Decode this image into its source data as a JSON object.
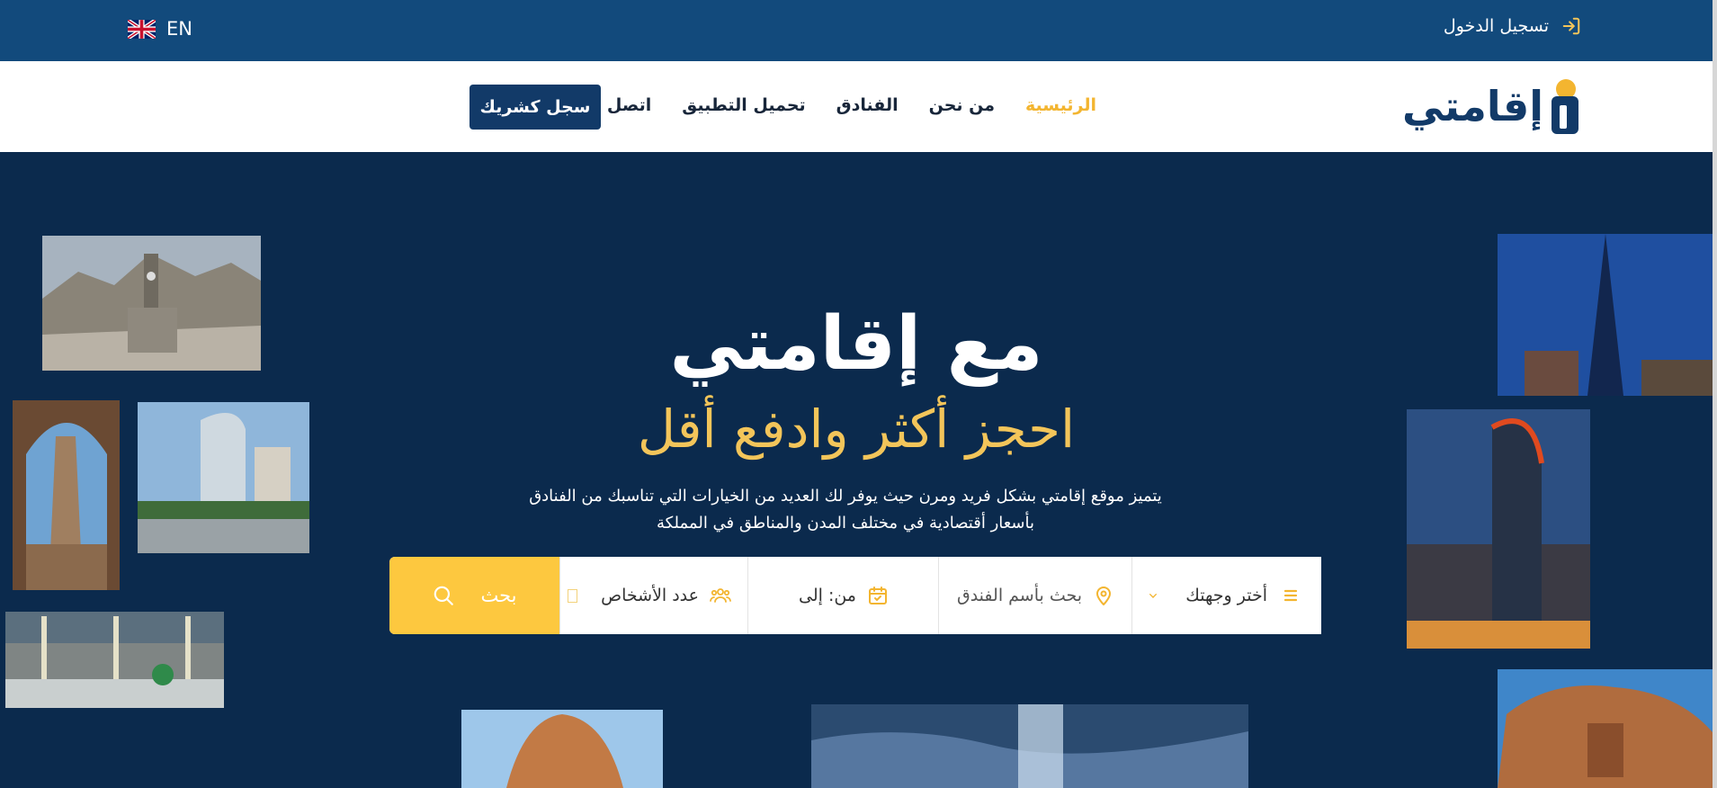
{
  "topbar": {
    "language_label": "EN",
    "login_label": "تسجيل الدخول"
  },
  "brand": {
    "logo_text": "إقامتي",
    "primary_color": "#123a68",
    "accent_color": "#f3b530"
  },
  "nav": {
    "items": [
      {
        "label": "الرئيسية",
        "active": true
      },
      {
        "label": "من نحن",
        "active": false
      },
      {
        "label": "الفنادق",
        "active": false
      },
      {
        "label": "تحميل التطبيق",
        "active": false
      },
      {
        "label": "اتصل بنا",
        "active": false
      }
    ],
    "partner_button": "سجل كشريك"
  },
  "hero": {
    "title": "مع إقامتي",
    "subtitle": "احجز أكثر وادفع أقل",
    "description_line1": "يتميز موقع إقامتي بشكل فريد ومرن حيث يوفر لك العديد من الخيارات التي تناسبك من الفنادق",
    "description_line2": "بأسعار أقتصادية في مختلف المدن والمناطق في المملكة"
  },
  "search": {
    "destination_label": "أختر وجهتك",
    "hotel_name_placeholder": "بحث بأسم الفندق",
    "dates_label": "من: إلى",
    "guests_label": "عدد الأشخاص",
    "search_button": "بحث"
  },
  "icons": {
    "login": "sign-in-icon",
    "flag": "uk-flag-icon",
    "destination": "list-icon",
    "dropdown": "chevron-down-icon",
    "location": "map-pin-icon",
    "calendar": "calendar-check-icon",
    "guests": "users-icon",
    "search": "search-icon"
  }
}
